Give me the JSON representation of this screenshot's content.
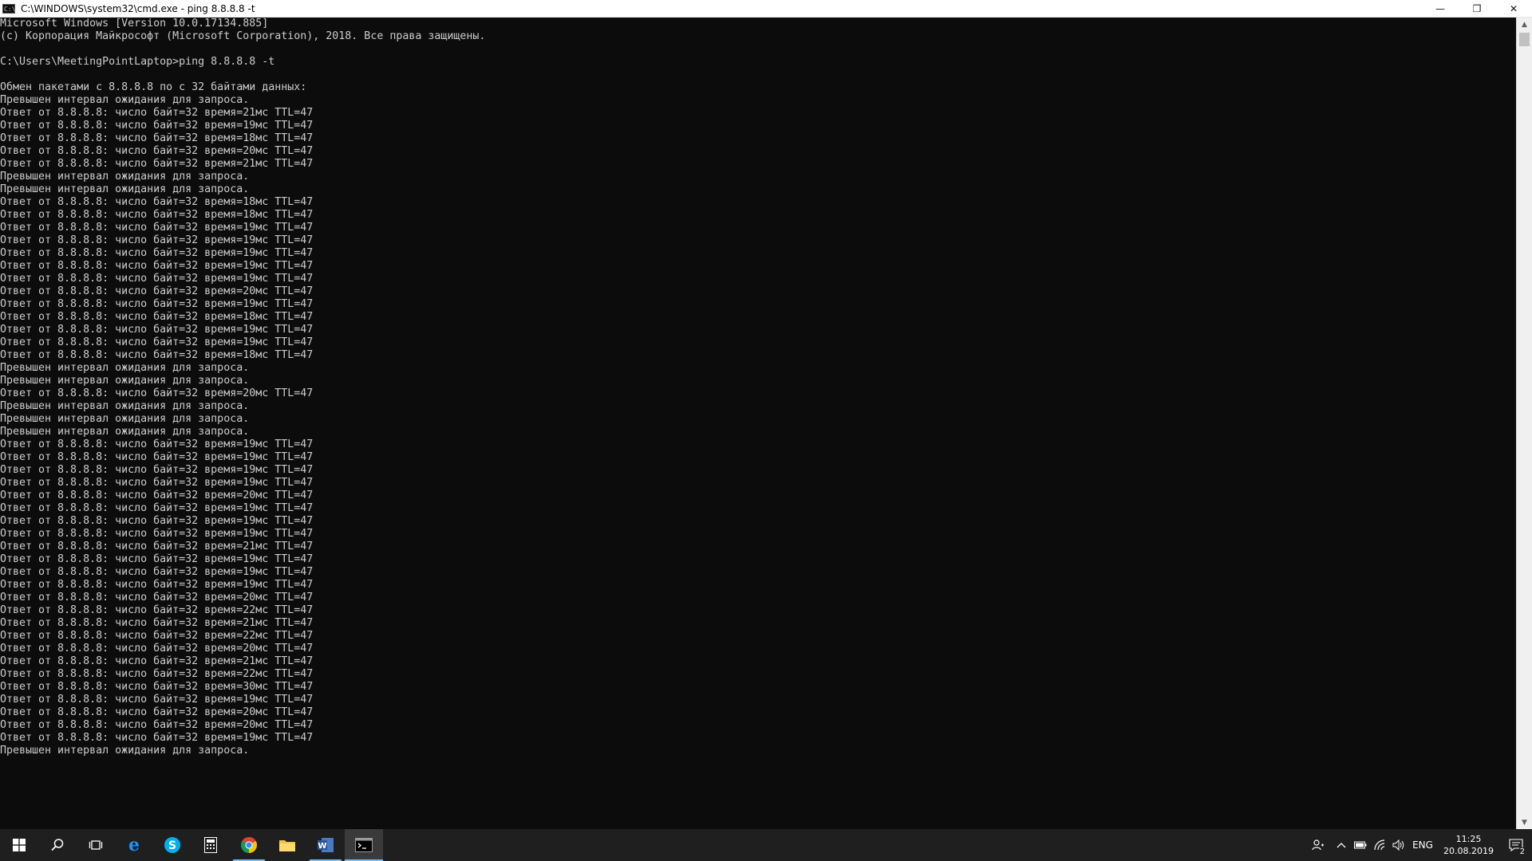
{
  "window": {
    "title": "C:\\WINDOWS\\system32\\cmd.exe - ping  8.8.8.8 -t",
    "app_icon_text": "C:\\",
    "minimize_glyph": "—",
    "maximize_glyph": "❐",
    "close_glyph": "✕"
  },
  "console": {
    "lines": [
      "Microsoft Windows [Version 10.0.17134.885]",
      "(c) Корпорация Майкрософт (Microsoft Corporation), 2018. Все права защищены.",
      "",
      "C:\\Users\\MeetingPointLaptop>ping 8.8.8.8 -t",
      "",
      "Обмен пакетами с 8.8.8.8 по с 32 байтами данных:",
      "Превышен интервал ожидания для запроса.",
      "Ответ от 8.8.8.8: число байт=32 время=21мс TTL=47",
      "Ответ от 8.8.8.8: число байт=32 время=19мс TTL=47",
      "Ответ от 8.8.8.8: число байт=32 время=18мс TTL=47",
      "Ответ от 8.8.8.8: число байт=32 время=20мс TTL=47",
      "Ответ от 8.8.8.8: число байт=32 время=21мс TTL=47",
      "Превышен интервал ожидания для запроса.",
      "Превышен интервал ожидания для запроса.",
      "Ответ от 8.8.8.8: число байт=32 время=18мс TTL=47",
      "Ответ от 8.8.8.8: число байт=32 время=18мс TTL=47",
      "Ответ от 8.8.8.8: число байт=32 время=19мс TTL=47",
      "Ответ от 8.8.8.8: число байт=32 время=19мс TTL=47",
      "Ответ от 8.8.8.8: число байт=32 время=19мс TTL=47",
      "Ответ от 8.8.8.8: число байт=32 время=19мс TTL=47",
      "Ответ от 8.8.8.8: число байт=32 время=19мс TTL=47",
      "Ответ от 8.8.8.8: число байт=32 время=20мс TTL=47",
      "Ответ от 8.8.8.8: число байт=32 время=19мс TTL=47",
      "Ответ от 8.8.8.8: число байт=32 время=18мс TTL=47",
      "Ответ от 8.8.8.8: число байт=32 время=19мс TTL=47",
      "Ответ от 8.8.8.8: число байт=32 время=19мс TTL=47",
      "Ответ от 8.8.8.8: число байт=32 время=18мс TTL=47",
      "Превышен интервал ожидания для запроса.",
      "Превышен интервал ожидания для запроса.",
      "Ответ от 8.8.8.8: число байт=32 время=20мс TTL=47",
      "Превышен интервал ожидания для запроса.",
      "Превышен интервал ожидания для запроса.",
      "Превышен интервал ожидания для запроса.",
      "Ответ от 8.8.8.8: число байт=32 время=19мс TTL=47",
      "Ответ от 8.8.8.8: число байт=32 время=19мс TTL=47",
      "Ответ от 8.8.8.8: число байт=32 время=19мс TTL=47",
      "Ответ от 8.8.8.8: число байт=32 время=19мс TTL=47",
      "Ответ от 8.8.8.8: число байт=32 время=20мс TTL=47",
      "Ответ от 8.8.8.8: число байт=32 время=19мс TTL=47",
      "Ответ от 8.8.8.8: число байт=32 время=19мс TTL=47",
      "Ответ от 8.8.8.8: число байт=32 время=19мс TTL=47",
      "Ответ от 8.8.8.8: число байт=32 время=21мс TTL=47",
      "Ответ от 8.8.8.8: число байт=32 время=19мс TTL=47",
      "Ответ от 8.8.8.8: число байт=32 время=19мс TTL=47",
      "Ответ от 8.8.8.8: число байт=32 время=19мс TTL=47",
      "Ответ от 8.8.8.8: число байт=32 время=20мс TTL=47",
      "Ответ от 8.8.8.8: число байт=32 время=22мс TTL=47",
      "Ответ от 8.8.8.8: число байт=32 время=21мс TTL=47",
      "Ответ от 8.8.8.8: число байт=32 время=22мс TTL=47",
      "Ответ от 8.8.8.8: число байт=32 время=20мс TTL=47",
      "Ответ от 8.8.8.8: число байт=32 время=21мс TTL=47",
      "Ответ от 8.8.8.8: число байт=32 время=22мс TTL=47",
      "Ответ от 8.8.8.8: число байт=32 время=30мс TTL=47",
      "Ответ от 8.8.8.8: число байт=32 время=19мс TTL=47",
      "Ответ от 8.8.8.8: число байт=32 время=20мс TTL=47",
      "Ответ от 8.8.8.8: число байт=32 время=20мс TTL=47",
      "Ответ от 8.8.8.8: число байт=32 время=19мс TTL=47",
      "Превышен интервал ожидания для запроса."
    ]
  },
  "taskbar": {
    "apps": [
      {
        "name": "start-button",
        "icon": "windows-logo-icon",
        "interactable": true
      },
      {
        "name": "search-button",
        "icon": "search-icon"
      },
      {
        "name": "task-view-button",
        "icon": "task-view-icon"
      },
      {
        "name": "edge-button",
        "icon": "edge-icon",
        "color": "#1e90ff"
      },
      {
        "name": "skype-button",
        "icon": "skype-icon",
        "color": "#00aff0"
      },
      {
        "name": "calculator-button",
        "icon": "calculator-icon"
      },
      {
        "name": "chrome-button",
        "icon": "chrome-icon",
        "running": true
      },
      {
        "name": "file-explorer-button",
        "icon": "folder-icon",
        "color": "#f3c34b"
      },
      {
        "name": "word-button",
        "icon": "word-icon",
        "color": "#2b579a",
        "running": true
      },
      {
        "name": "cmd-button",
        "icon": "cmd-icon",
        "active": true
      }
    ],
    "tray": {
      "language": "ENG",
      "time": "11:25",
      "date": "20.08.2019",
      "notification_count": "2"
    }
  },
  "colors": {
    "console_bg": "#0c0c0c",
    "console_fg": "#cccccc",
    "taskbar_bg": "#1f1f1f",
    "accent": "#76b9ed"
  }
}
